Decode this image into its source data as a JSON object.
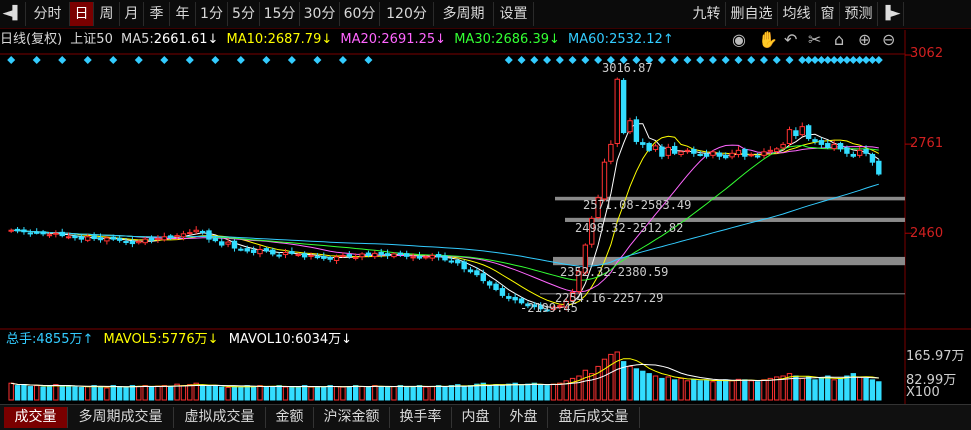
{
  "toolbar": {
    "left_arrow": "◄▌",
    "tabs": [
      "分时",
      "日",
      "周",
      "月",
      "季",
      "年",
      "1分",
      "5分",
      "15分",
      "30分",
      "60分",
      "120分",
      "多周期",
      "设置"
    ],
    "active_tab": "日",
    "right_items": [
      "九转",
      "删自选",
      "均线",
      "窗",
      "预测"
    ],
    "right_arrow": "▐►"
  },
  "info": {
    "period": "日线(复权)",
    "symbol": "上证50",
    "ma5_label": "MA5:",
    "ma5_value": "2661.61↓",
    "ma10_label": "MA10:",
    "ma10_value": "2687.79↓",
    "ma20_label": "MA20:",
    "ma20_value": "2691.25↓",
    "ma30_label": "MA30:",
    "ma30_value": "2686.39↓",
    "ma60_label": "MA60:",
    "ma60_value": "2532.12↑",
    "colors": {
      "ma5": "#ffffff",
      "ma10": "#ffff00",
      "ma20": "#ff66ff",
      "ma30": "#33ff33",
      "ma60": "#33ccff"
    }
  },
  "icons": [
    "eye-icon",
    "hand-icon",
    "undo-icon",
    "scissors-icon",
    "lock-icon",
    "zoom-in-icon",
    "zoom-out-icon"
  ],
  "price_axis": {
    "top": "3062",
    "mid1": "2761",
    "mid2": "2460"
  },
  "annotations": {
    "high": "3016.87",
    "low": "2199.45",
    "gap1": "2571.08-2583.49",
    "gap2": "2498.32-2512.82",
    "gap3": "2352.32-2380.59",
    "gap4": "2254.16-2257.29"
  },
  "volume": {
    "label": "总手:",
    "value": "4855万↑",
    "mavol5_label": "MAVOL5:",
    "mavol5_value": "5776万↓",
    "mavol10_label": "MAVOL10:",
    "mavol10_value": "6034万↓",
    "axis_top": "165.97万",
    "axis_mid": "82.99万",
    "axis_unit": "X100"
  },
  "bottom_tabs": [
    "成交量",
    "多周期成交量",
    "虚拟成交量",
    "金额",
    "沪深金额",
    "换手率",
    "内盘",
    "外盘",
    "盘后成交量"
  ],
  "bottom_active": "成交量",
  "chart_data": {
    "type": "candlestick",
    "ylim": [
      2150,
      3062
    ],
    "closes": [
      2470,
      2468,
      2465,
      2460,
      2462,
      2458,
      2455,
      2460,
      2452,
      2448,
      2445,
      2440,
      2448,
      2442,
      2438,
      2444,
      2440,
      2436,
      2430,
      2425,
      2432,
      2440,
      2436,
      2442,
      2448,
      2445,
      2452,
      2458,
      2462,
      2470,
      2465,
      2440,
      2435,
      2420,
      2430,
      2410,
      2405,
      2400,
      2395,
      2405,
      2400,
      2390,
      2385,
      2395,
      2392,
      2388,
      2380,
      2385,
      2378,
      2375,
      2372,
      2380,
      2385,
      2382,
      2378,
      2390,
      2385,
      2392,
      2388,
      2385,
      2390,
      2388,
      2382,
      2380,
      2376,
      2380,
      2385,
      2380,
      2370,
      2365,
      2360,
      2340,
      2330,
      2320,
      2300,
      2285,
      2270,
      2250,
      2240,
      2235,
      2225,
      2215,
      2212,
      2205,
      2200,
      2210,
      2215,
      2230,
      2260,
      2330,
      2420,
      2510,
      2580,
      2700,
      2760,
      2980,
      2800,
      2840,
      2770,
      2760,
      2740,
      2755,
      2720,
      2750,
      2730,
      2735,
      2740,
      2730,
      2725,
      2720,
      2735,
      2720,
      2715,
      2730,
      2740,
      2720,
      2725,
      2720,
      2735,
      2740,
      2745,
      2760,
      2810,
      2790,
      2820,
      2780,
      2770,
      2760,
      2750,
      2760,
      2745,
      2730,
      2720,
      2740,
      2730,
      2700,
      2660
    ],
    "vol_ratio": [
      0.35,
      0.3,
      0.32,
      0.28,
      0.3,
      0.27,
      0.3,
      0.32,
      0.28,
      0.3,
      0.27,
      0.26,
      0.28,
      0.3,
      0.27,
      0.25,
      0.3,
      0.28,
      0.27,
      0.3,
      0.28,
      0.3,
      0.27,
      0.29,
      0.3,
      0.28,
      0.33,
      0.3,
      0.32,
      0.35,
      0.3,
      0.28,
      0.3,
      0.27,
      0.26,
      0.28,
      0.27,
      0.3,
      0.28,
      0.3,
      0.27,
      0.28,
      0.3,
      0.27,
      0.26,
      0.28,
      0.3,
      0.27,
      0.28,
      0.27,
      0.3,
      0.28,
      0.27,
      0.28,
      0.3,
      0.28,
      0.27,
      0.3,
      0.28,
      0.27,
      0.28,
      0.3,
      0.27,
      0.28,
      0.3,
      0.27,
      0.28,
      0.3,
      0.27,
      0.3,
      0.32,
      0.28,
      0.3,
      0.33,
      0.35,
      0.3,
      0.32,
      0.3,
      0.33,
      0.35,
      0.3,
      0.33,
      0.35,
      0.32,
      0.3,
      0.33,
      0.35,
      0.4,
      0.45,
      0.5,
      0.62,
      0.55,
      0.7,
      0.85,
      0.95,
      1.0,
      0.8,
      0.7,
      0.65,
      0.6,
      0.55,
      0.5,
      0.45,
      0.48,
      0.42,
      0.45,
      0.4,
      0.43,
      0.4,
      0.42,
      0.38,
      0.4,
      0.42,
      0.4,
      0.43,
      0.42,
      0.4,
      0.38,
      0.42,
      0.45,
      0.48,
      0.5,
      0.55,
      0.5,
      0.45,
      0.48,
      0.42,
      0.45,
      0.5,
      0.42,
      0.45,
      0.5,
      0.55,
      0.48,
      0.45,
      0.42,
      0.38
    ]
  }
}
